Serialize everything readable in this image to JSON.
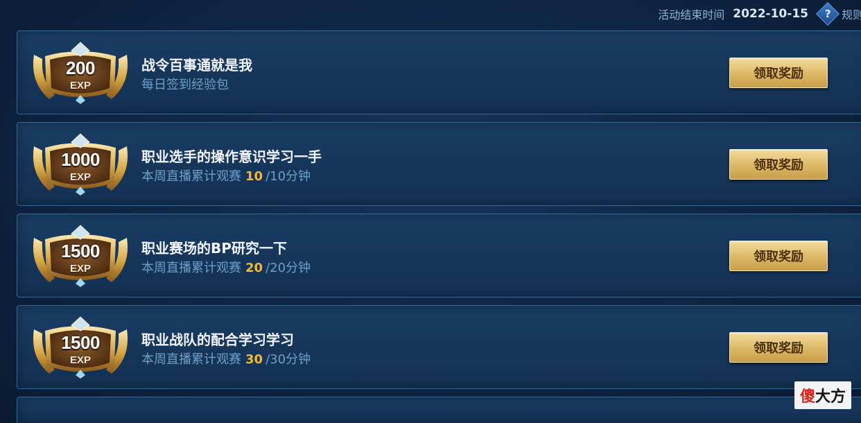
{
  "header": {
    "end_time_label": "活动结束时间",
    "end_time_value": "2022-10-15",
    "help_icon": "question-icon",
    "rules_label": "规则"
  },
  "tasks": [
    {
      "exp_value": "200",
      "exp_unit": "EXP",
      "title": "战令百事通就是我",
      "desc": "每日签到经验包",
      "progress_current": "",
      "progress_total": "",
      "button_label": "领取奖励"
    },
    {
      "exp_value": "1000",
      "exp_unit": "EXP",
      "title": "职业选手的操作意识学习一手",
      "desc": "本周直播累计观赛",
      "progress_current": "10",
      "progress_total": "/10分钟",
      "button_label": "领取奖励"
    },
    {
      "exp_value": "1500",
      "exp_unit": "EXP",
      "title": "职业赛场的BP研究一下",
      "desc": "本周直播累计观赛",
      "progress_current": "20",
      "progress_total": "/20分钟",
      "button_label": "领取奖励"
    },
    {
      "exp_value": "1500",
      "exp_unit": "EXP",
      "title": "职业战队的配合学习学习",
      "desc": "本周直播累计观赛",
      "progress_current": "30",
      "progress_total": "/30分钟",
      "button_label": "领取奖励"
    }
  ],
  "watermark": {
    "red_part": "傻",
    "black_part": "大方"
  },
  "colors": {
    "progress_highlight": "#f5b732",
    "button_gold": "#dcb764",
    "subtitle_blue": "#6d9fca"
  }
}
